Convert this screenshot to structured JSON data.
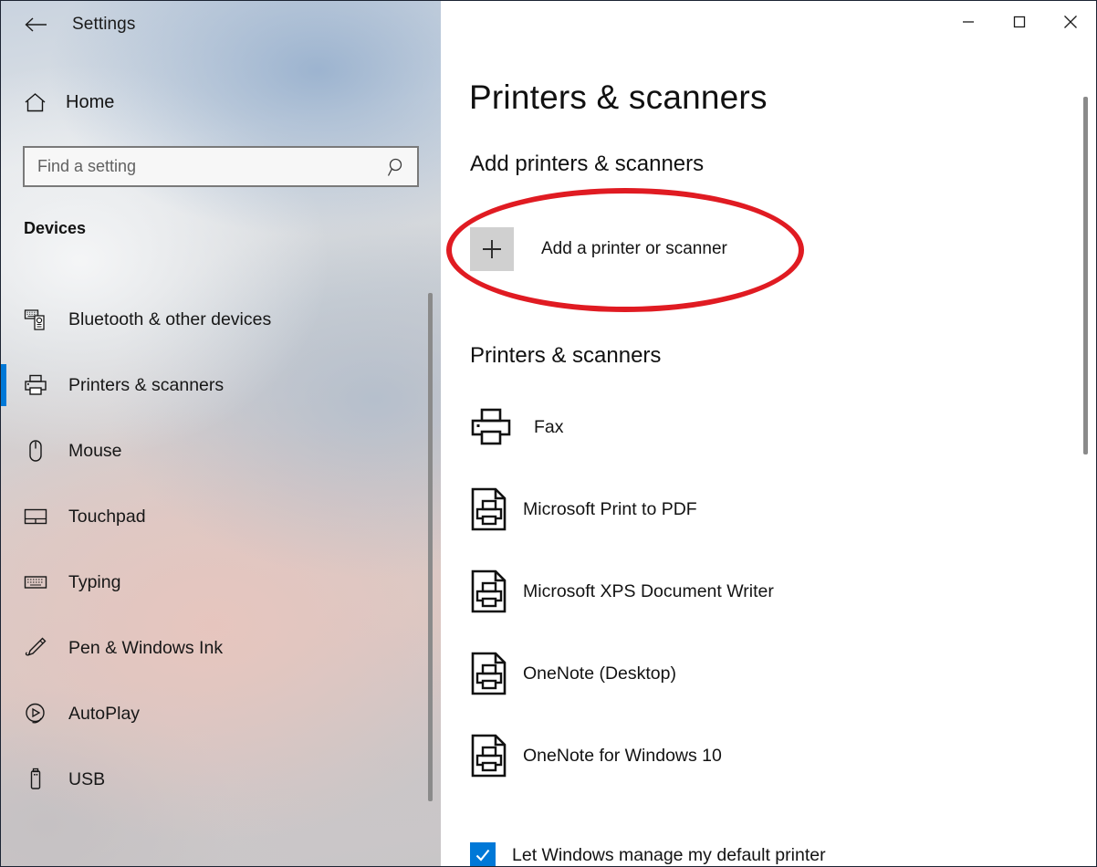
{
  "window": {
    "title": "Settings",
    "back_icon": "back-arrow-icon",
    "controls": {
      "minimize": "minimize-icon",
      "maximize": "maximize-icon",
      "close": "close-icon"
    }
  },
  "sidebar": {
    "home_label": "Home",
    "home_icon": "home-icon",
    "search": {
      "placeholder": "Find a setting",
      "value": "",
      "icon": "search-icon"
    },
    "section_heading": "Devices",
    "items": [
      {
        "label": "Bluetooth & other devices",
        "icon": "bluetooth-devices-icon",
        "selected": false
      },
      {
        "label": "Printers & scanners",
        "icon": "printer-icon",
        "selected": true
      },
      {
        "label": "Mouse",
        "icon": "mouse-icon",
        "selected": false
      },
      {
        "label": "Touchpad",
        "icon": "touchpad-icon",
        "selected": false
      },
      {
        "label": "Typing",
        "icon": "keyboard-icon",
        "selected": false
      },
      {
        "label": "Pen & Windows Ink",
        "icon": "pen-icon",
        "selected": false
      },
      {
        "label": "AutoPlay",
        "icon": "autoplay-icon",
        "selected": false
      },
      {
        "label": "USB",
        "icon": "usb-icon",
        "selected": false
      }
    ],
    "accent_color": "#0078d7"
  },
  "main": {
    "page_title": "Printers & scanners",
    "add_section": {
      "heading": "Add printers & scanners",
      "button_label": "Add a printer or scanner",
      "button_icon": "plus-icon"
    },
    "list_section": {
      "heading": "Printers & scanners",
      "printers": [
        {
          "name": "Fax",
          "icon": "fax-printer-icon"
        },
        {
          "name": "Microsoft Print to PDF",
          "icon": "document-printer-icon"
        },
        {
          "name": "Microsoft XPS Document Writer",
          "icon": "document-printer-icon"
        },
        {
          "name": "OneNote (Desktop)",
          "icon": "document-printer-icon"
        },
        {
          "name": "OneNote for Windows 10",
          "icon": "document-printer-icon"
        }
      ]
    },
    "default_printer": {
      "label": "Let Windows manage my default printer",
      "checked": true,
      "checkbox_color": "#0078d7"
    }
  },
  "annotation": {
    "type": "ellipse-highlight",
    "color": "#e01b22",
    "targets": "Add a printer or scanner"
  }
}
